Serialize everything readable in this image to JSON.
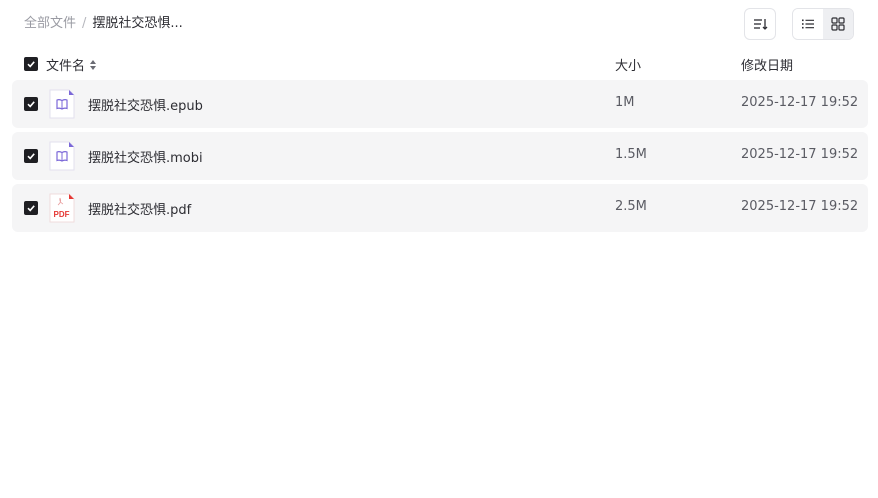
{
  "breadcrumb": {
    "root": "全部文件",
    "separator": "/",
    "current": "摆脱社交恐惧..."
  },
  "toolbar": {
    "sort_icon": "sort-icon",
    "list_view_icon": "list-view-icon",
    "grid_view_icon": "grid-view-icon"
  },
  "table": {
    "columns": {
      "name": "文件名",
      "size": "大小",
      "modified": "修改日期"
    },
    "rows": [
      {
        "name": "摆脱社交恐惧.epub",
        "size": "1M",
        "modified": "2025-12-17 19:52",
        "icon": "ebook-icon",
        "checked": true
      },
      {
        "name": "摆脱社交恐惧.mobi",
        "size": "1.5M",
        "modified": "2025-12-17 19:52",
        "icon": "ebook-icon",
        "checked": true
      },
      {
        "name": "摆脱社交恐惧.pdf",
        "size": "2.5M",
        "modified": "2025-12-17 19:52",
        "icon": "pdf-icon",
        "pdf_label": "PDF",
        "checked": true
      }
    ]
  },
  "colors": {
    "row_background": "#f5f5f6",
    "checkbox": "#1f1f23",
    "ebook_accent": "#7b68d8",
    "pdf_accent": "#e53935"
  }
}
